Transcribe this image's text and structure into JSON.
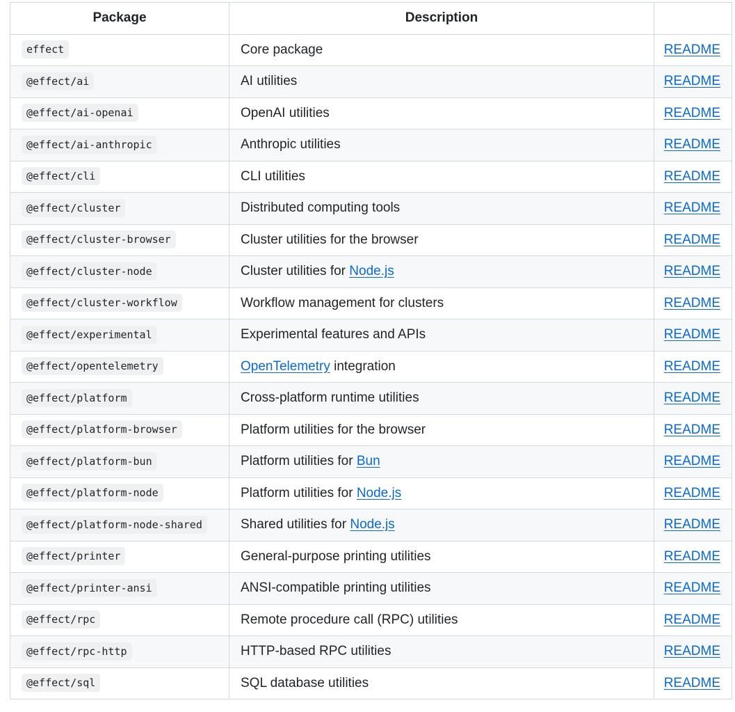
{
  "table": {
    "headers": [
      "Package",
      "Description",
      ""
    ],
    "link_label": "README",
    "rows": [
      {
        "pkg": "effect",
        "desc": [
          {
            "t": "Core package"
          }
        ]
      },
      {
        "pkg": "@effect/ai",
        "desc": [
          {
            "t": "AI utilities"
          }
        ]
      },
      {
        "pkg": "@effect/ai-openai",
        "desc": [
          {
            "t": "OpenAI utilities"
          }
        ]
      },
      {
        "pkg": "@effect/ai-anthropic",
        "desc": [
          {
            "t": "Anthropic utilities"
          }
        ]
      },
      {
        "pkg": "@effect/cli",
        "desc": [
          {
            "t": "CLI utilities"
          }
        ]
      },
      {
        "pkg": "@effect/cluster",
        "desc": [
          {
            "t": "Distributed computing tools"
          }
        ]
      },
      {
        "pkg": "@effect/cluster-browser",
        "desc": [
          {
            "t": "Cluster utilities for the browser"
          }
        ]
      },
      {
        "pkg": "@effect/cluster-node",
        "desc": [
          {
            "t": "Cluster utilities for "
          },
          {
            "t": "Node.js",
            "link": true
          }
        ]
      },
      {
        "pkg": "@effect/cluster-workflow",
        "desc": [
          {
            "t": "Workflow management for clusters"
          }
        ]
      },
      {
        "pkg": "@effect/experimental",
        "desc": [
          {
            "t": "Experimental features and APIs"
          }
        ]
      },
      {
        "pkg": "@effect/opentelemetry",
        "desc": [
          {
            "t": "OpenTelemetry",
            "link": true
          },
          {
            "t": " integration"
          }
        ]
      },
      {
        "pkg": "@effect/platform",
        "desc": [
          {
            "t": "Cross-platform runtime utilities"
          }
        ]
      },
      {
        "pkg": "@effect/platform-browser",
        "desc": [
          {
            "t": "Platform utilities for the browser"
          }
        ]
      },
      {
        "pkg": "@effect/platform-bun",
        "desc": [
          {
            "t": "Platform utilities for "
          },
          {
            "t": "Bun",
            "link": true
          }
        ]
      },
      {
        "pkg": "@effect/platform-node",
        "desc": [
          {
            "t": "Platform utilities for "
          },
          {
            "t": "Node.js",
            "link": true
          }
        ]
      },
      {
        "pkg": "@effect/platform-node-shared",
        "desc": [
          {
            "t": "Shared utilities for "
          },
          {
            "t": "Node.js",
            "link": true
          }
        ]
      },
      {
        "pkg": "@effect/printer",
        "desc": [
          {
            "t": "General-purpose printing utilities"
          }
        ]
      },
      {
        "pkg": "@effect/printer-ansi",
        "desc": [
          {
            "t": "ANSI-compatible printing utilities"
          }
        ]
      },
      {
        "pkg": "@effect/rpc",
        "desc": [
          {
            "t": "Remote procedure call (RPC) utilities"
          }
        ]
      },
      {
        "pkg": "@effect/rpc-http",
        "desc": [
          {
            "t": "HTTP-based RPC utilities"
          }
        ]
      },
      {
        "pkg": "@effect/sql",
        "desc": [
          {
            "t": "SQL database utilities"
          }
        ]
      }
    ]
  }
}
